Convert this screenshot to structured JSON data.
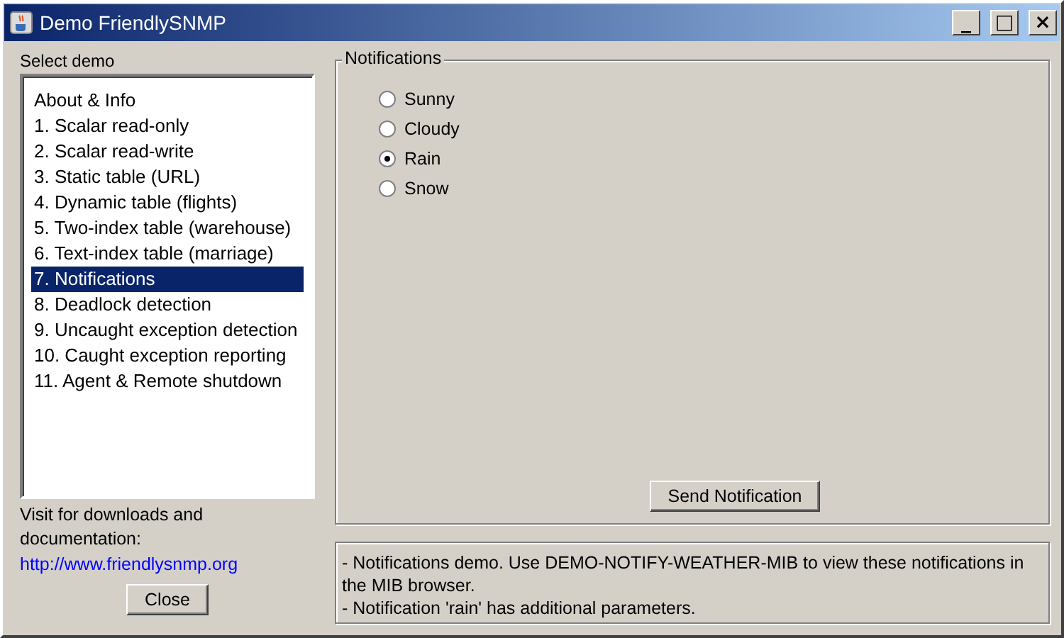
{
  "window": {
    "title": "Demo FriendlySNMP",
    "controls": [
      "_",
      "□",
      "×"
    ]
  },
  "sidebar": {
    "label": "Select demo",
    "items": [
      {
        "label": "About & Info",
        "selected": false
      },
      {
        "label": "1. Scalar read-only",
        "selected": false
      },
      {
        "label": "2. Scalar read-write",
        "selected": false
      },
      {
        "label": "3. Static table (URL)",
        "selected": false
      },
      {
        "label": "4. Dynamic table (flights)",
        "selected": false
      },
      {
        "label": "5. Two-index table (warehouse)",
        "selected": false
      },
      {
        "label": "6. Text-index table (marriage)",
        "selected": false
      },
      {
        "label": "7. Notifications",
        "selected": true
      },
      {
        "label": "8. Deadlock detection",
        "selected": false
      },
      {
        "label": "9. Uncaught exception detection",
        "selected": false
      },
      {
        "label": "10. Caught exception reporting",
        "selected": false
      },
      {
        "label": "11. Agent & Remote shutdown",
        "selected": false
      }
    ],
    "visit_text": "Visit for downloads and documentation:",
    "link": "http://www.friendlysnmp.org",
    "close_button": "Close"
  },
  "panel": {
    "title": "Notifications",
    "options": [
      {
        "label": "Sunny",
        "selected": false
      },
      {
        "label": "Cloudy",
        "selected": false
      },
      {
        "label": "Rain",
        "selected": true
      },
      {
        "label": "Snow",
        "selected": false
      }
    ],
    "button": "Send Notification"
  },
  "description": [
    " - Notifications demo. Use DEMO-NOTIFY-WEATHER-MIB to view these notifications in the MIB browser.",
    " - Notification 'rain' has additional parameters."
  ]
}
